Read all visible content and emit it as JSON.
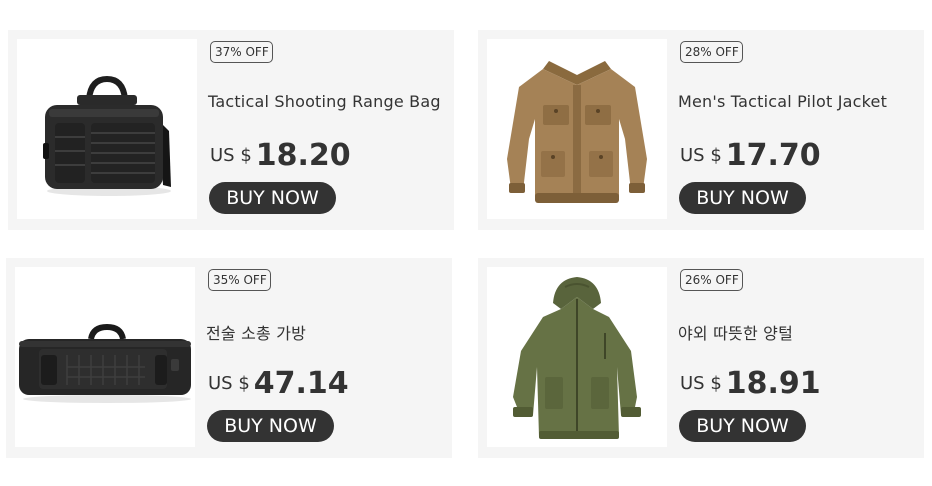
{
  "products": [
    {
      "discount": "37% OFF",
      "name": "Tactical Shooting Range Bag",
      "currency": "US $",
      "price": "18.20",
      "button": "BUY NOW",
      "image": "black-range-bag"
    },
    {
      "discount": "28% OFF",
      "name": "Men's Tactical Pilot Jacket",
      "currency": "US $",
      "price": "17.70",
      "button": "BUY NOW",
      "image": "khaki-pilot-jacket"
    },
    {
      "discount": "35% OFF",
      "name": "전술 소총 가방",
      "currency": "US $",
      "price": "47.14",
      "button": "BUY NOW",
      "image": "black-rifle-bag"
    },
    {
      "discount": "26% OFF",
      "name": "야외 따뜻한 양털",
      "currency": "US $",
      "price": "18.91",
      "button": "BUY NOW",
      "image": "green-fleece-jacket"
    }
  ],
  "colors": {
    "card_background": "#f5f5f5",
    "button": "#333333",
    "text": "#333333"
  }
}
